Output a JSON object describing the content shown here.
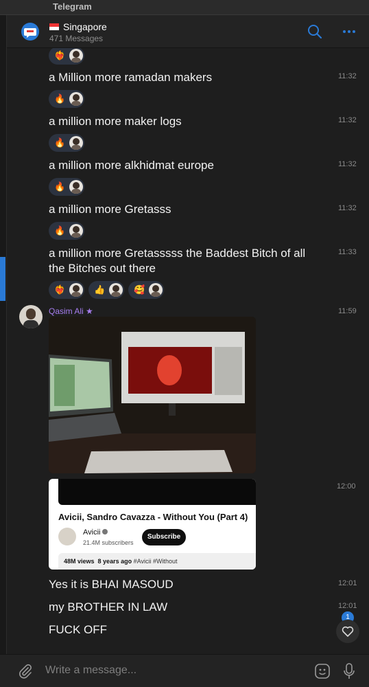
{
  "app": {
    "title": "Telegram"
  },
  "chat_header": {
    "name": "Singapore",
    "flag_icon": "singapore-flag-icon",
    "subtitle": "471 Messages",
    "accent": "#2a7ad6"
  },
  "messages": [
    {
      "text": "a Million more ramadan makers",
      "time": "11:32",
      "reaction": "🔥"
    },
    {
      "text": "a million more maker logs",
      "time": "11:32",
      "reaction": "🔥"
    },
    {
      "text": "a million more alkhidmat europe",
      "time": "11:32",
      "reaction": "🔥"
    },
    {
      "text": "a million more Gretasss",
      "time": "11:32",
      "reaction": "🔥"
    },
    {
      "text": "a million more Gretasssss the Baddest Bitch of all the Bitches out there",
      "time": "11:33"
    }
  ],
  "top_reaction": "❤️‍🔥",
  "last_reactions": [
    "❤️‍🔥",
    "👍",
    "🥰"
  ],
  "photo_message": {
    "sender": "Qasim Ali",
    "sender_badge": "★",
    "time": "11:59"
  },
  "link_preview": {
    "time": "12:00",
    "title": "Avicii, Sandro Cavazza - Without You (Part 4)",
    "channel": "Avicii",
    "subscribers": "21.4M subscribers",
    "subscribe": "Subscribe",
    "views": "48M views",
    "age": "8 years ago",
    "tags": "#Avicii #Without"
  },
  "tail_messages": [
    {
      "text": "Yes it is BHAI MASOUD",
      "time": "12:01"
    },
    {
      "text": "my BROTHER IN LAW",
      "time": "12:01"
    },
    {
      "text": "FUCK OFF",
      "time": ""
    }
  ],
  "unread_count": "1",
  "composer": {
    "placeholder": "Write a message..."
  }
}
